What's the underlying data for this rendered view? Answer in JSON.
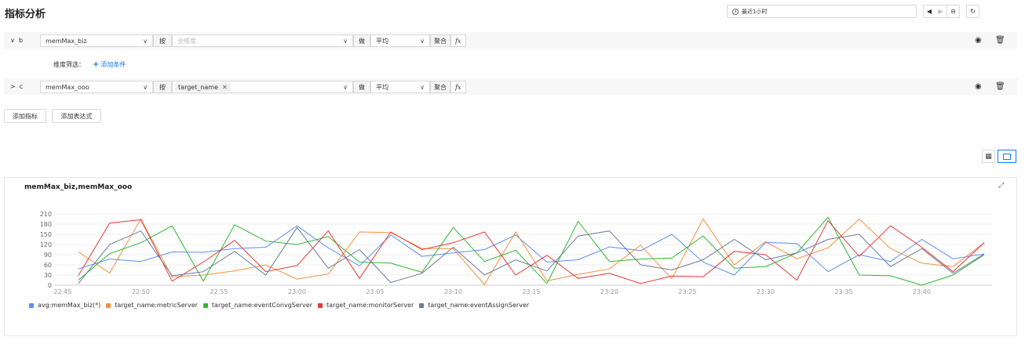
{
  "page": {
    "title": "指标分析"
  },
  "toolbar": {
    "time_range": "最近1小时",
    "prev_icon": "◀",
    "next_icon": "▶",
    "zoom_icon": "⊖",
    "refresh_icon": "↻"
  },
  "queries": [
    {
      "expand_icon": "∨",
      "label": "b",
      "metric": "memMax_biz",
      "group_by_label": "按",
      "dimensions_placeholder": "全维度",
      "dimension_tags": [],
      "do_label": "做",
      "aggregation": "平均",
      "agg_label": "聚合",
      "fx_label": "fx"
    },
    {
      "expand_icon": ">",
      "label": "c",
      "metric": "memMax_ooo",
      "group_by_label": "按",
      "dimensions_placeholder": "",
      "dimension_tags": [
        "target_name"
      ],
      "do_label": "做",
      "aggregation": "平均",
      "agg_label": "聚合",
      "fx_label": "fx"
    }
  ],
  "dimension_filter": {
    "label": "维度筛选：",
    "add_condition": "添加条件"
  },
  "actions": {
    "add_metric": "添加指标",
    "add_expression": "添加表达式"
  },
  "chart_data": {
    "type": "line",
    "title": "memMax_biz,memMax_ooo",
    "x": [
      "22:46",
      "22:48",
      "22:50",
      "22:52",
      "22:54",
      "22:56",
      "22:58",
      "23:00",
      "23:02",
      "23:04",
      "23:06",
      "23:08",
      "23:10",
      "23:12",
      "23:14",
      "23:16",
      "23:18",
      "23:20",
      "23:22",
      "23:24",
      "23:26",
      "23:28",
      "23:30",
      "23:32",
      "23:34",
      "23:36",
      "23:38",
      "23:40",
      "23:42",
      "23:44"
    ],
    "xticks": [
      "22:45",
      "22:50",
      "22:55",
      "23:00",
      "23:05",
      "23:10",
      "23:15",
      "23:20",
      "23:25",
      "23:30",
      "23:35",
      "23:40"
    ],
    "yticks": [
      0,
      30,
      60,
      90,
      120,
      150,
      180,
      210
    ],
    "ylim": [
      0,
      210
    ],
    "legend_position": "bottom-left",
    "grid": true,
    "series": [
      {
        "name": "avg:memMax_biz(*)",
        "color": "#5b8ff9",
        "values": [
          48,
          77,
          70,
          98,
          97,
          108,
          112,
          175,
          110,
          57,
          148,
          85,
          95,
          105,
          148,
          68,
          75,
          113,
          102,
          150,
          68,
          30,
          126,
          123,
          40,
          90,
          70,
          135,
          78,
          92
        ]
      },
      {
        "name": "target_name:metricServer",
        "color": "#f6903d",
        "values": [
          98,
          36,
          195,
          25,
          30,
          42,
          60,
          18,
          33,
          157,
          155,
          108,
          108,
          2,
          157,
          13,
          32,
          48,
          118,
          19,
          195,
          60,
          128,
          78,
          110,
          195,
          108,
          65,
          55,
          125
        ]
      },
      {
        "name": "target_name:eventConvgServer",
        "color": "#2eb82e",
        "values": [
          15,
          93,
          125,
          175,
          12,
          178,
          130,
          120,
          143,
          68,
          65,
          38,
          170,
          70,
          103,
          5,
          188,
          70,
          77,
          80,
          145,
          50,
          55,
          95,
          200,
          30,
          28,
          0,
          30,
          90
        ]
      },
      {
        "name": "target_name:monitorServer",
        "color": "#e8383d",
        "values": [
          28,
          183,
          193,
          12,
          68,
          132,
          40,
          58,
          160,
          20,
          157,
          105,
          125,
          157,
          30,
          88,
          20,
          35,
          5,
          27,
          25,
          100,
          90,
          15,
          190,
          85,
          175,
          112,
          40,
          125
        ]
      },
      {
        "name": "target_name:eventAssignServer",
        "color": "#6b7b9c",
        "values": [
          5,
          120,
          160,
          28,
          40,
          100,
          30,
          170,
          50,
          105,
          8,
          35,
          112,
          30,
          75,
          42,
          145,
          160,
          60,
          45,
          75,
          135,
          75,
          95,
          135,
          150,
          55,
          108,
          35,
          92
        ]
      }
    ]
  }
}
